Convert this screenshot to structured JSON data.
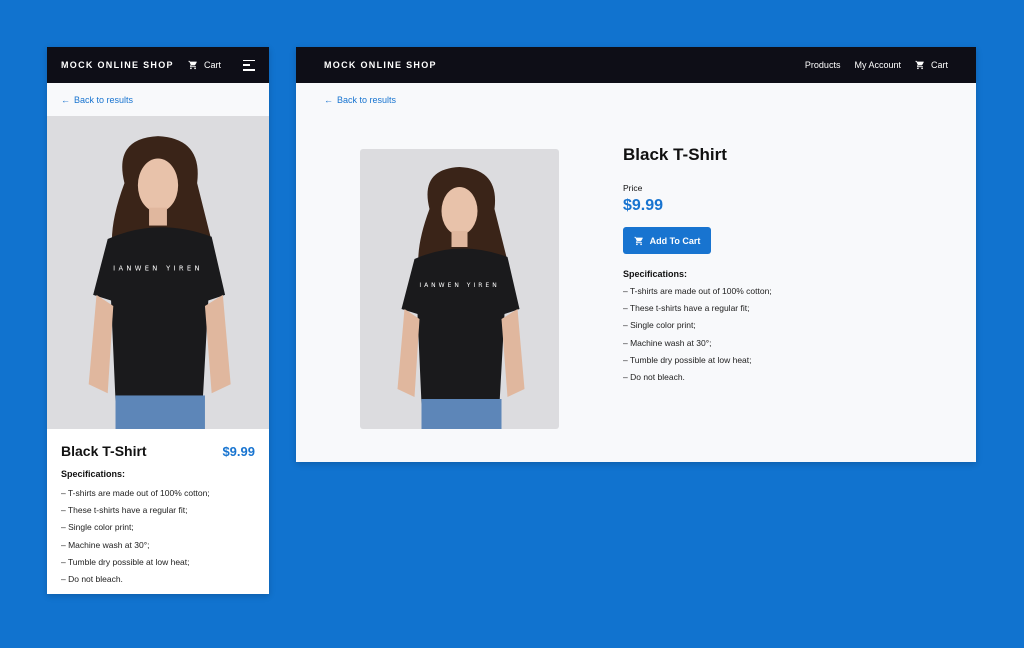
{
  "colors": {
    "background": "#1173cf",
    "navbar": "#0e0e17",
    "accent": "#1874d0"
  },
  "mobile": {
    "navbar": {
      "brand": "MOCK ONLINE SHOP",
      "cart_label": "Cart",
      "cart_icon": "cart-icon",
      "menu_icon": "hamburger-menu-icon"
    },
    "back_link": {
      "arrow": "←",
      "label": "Back to results"
    },
    "product": {
      "image_alt": "Woman wearing black t-shirt",
      "title": "Black T-Shirt",
      "price": "$9.99",
      "spec_heading": "Specifications:",
      "specs": [
        "– T-shirts are made out of 100% cotton;",
        "– These t-shirts have a regular fit;",
        "– Single color print;",
        "– Machine wash at 30°;",
        "– Tumble dry possible at low heat;",
        "– Do not bleach."
      ]
    }
  },
  "desktop": {
    "navbar": {
      "brand": "MOCK ONLINE SHOP",
      "links": [
        "Products",
        "My Account"
      ],
      "cart_label": "Cart",
      "cart_icon": "cart-icon"
    },
    "back_link": {
      "arrow": "←",
      "label": "Back to results"
    },
    "product": {
      "image_alt": "Woman wearing black t-shirt",
      "title": "Black T-Shirt",
      "price_label": "Price",
      "price": "$9.99",
      "add_to_cart_label": "Add To Cart",
      "spec_heading": "Specifications:",
      "specs": [
        "– T-shirts are made out of 100% cotton;",
        "– These t-shirts have a regular fit;",
        "– Single color print;",
        "– Machine wash at 30°;",
        "– Tumble dry possible at low heat;",
        "– Do not bleach."
      ]
    }
  }
}
